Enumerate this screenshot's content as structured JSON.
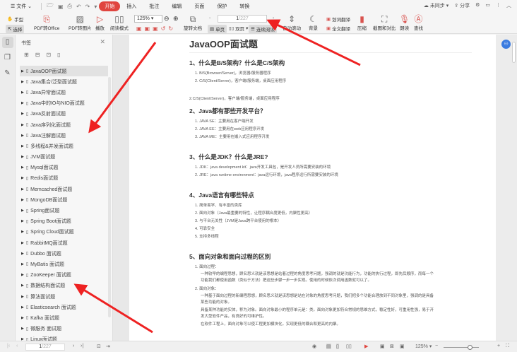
{
  "menubar": {
    "file": "文件",
    "items": [
      "开始",
      "插入",
      "批注",
      "编辑",
      "页面",
      "保护",
      "转换"
    ],
    "active": "开始",
    "sync": "未同步",
    "share": "分享"
  },
  "toolbar": {
    "hand": "手型",
    "select": "选择",
    "pdf_to_office": "PDF转Office",
    "pdf_to_image": "PDF转图片",
    "play": "播放",
    "read_mode": "阅读模式",
    "zoom": "125%",
    "rotate": "旋转文档",
    "page_current": "1",
    "page_total": "/227",
    "single": "单页",
    "double": "双页",
    "continuous": "连续阅读",
    "auto_scroll": "自动滚动",
    "background": "背景",
    "word_translate": "划词翻译",
    "full_translate": "全文翻译",
    "compress": "压缩",
    "screenshot_compare": "截图和对比",
    "read_aloud": "朗读",
    "find": "查找"
  },
  "panel": {
    "title": "书签",
    "bookmarks": [
      "JavaOOP面试题",
      "Java集合/泛型面试题",
      "Java异常面试题",
      "Java中的IO与NIO面试题",
      "Java反射面试题",
      "Java序列化面试题",
      "Java注解面试题",
      "多线程&并发面试题",
      "JVM面试题",
      "Mysql面试题",
      "Redis面试题",
      "Memcached面试题",
      "MongoDB面试题",
      "Spring面试题",
      "Spring Boot面试题",
      "Spring Cloud面试题",
      "RabbitMQ面试题",
      "Dubbo 面试题",
      "MyBatis 面试题",
      "ZooKeeper 面试题",
      "数据结构面试题",
      "算法面试题",
      "Elasticsearch 面试题",
      "Kafka 面试题",
      "微服务 面试题",
      "Linux面试题"
    ]
  },
  "doc": {
    "title": "JavaOOP面试题",
    "s1": {
      "h": "1、什么是B/S架构？什么是C/S架构",
      "items": [
        "1. B/S(Browser/Server)，浏览器/服务器程序",
        "2. C/S(Client/Server)，客户端/服务端，桌面应用程序"
      ],
      "extra": "2.C/S(Client/Server)，客户端/服务端，桌面应用程序"
    },
    "s2": {
      "h": "2、Java都有那些开发平台？",
      "items": [
        "1. JAVA SE：主要用在客户端开发",
        "2. JAVA EE：主要用在web应用程序开发",
        "3. JAVA ME：主要用在嵌入式应用程序开发"
      ]
    },
    "s3": {
      "h": "3、什么是JDK？什么是JRE?",
      "items": [
        "1. JDK：java development kit：java开发工具包，是开发人员所需要安装的环境",
        "2. JRE：java runtime environment：java运行环境，java程序运行所需要安装的环境"
      ]
    },
    "s4": {
      "h": "4、Java语言有哪些特点",
      "items": [
        "1. 简单易学、有丰富的类库",
        "2. 面向对象（Java最重要的特性，让程序耦合度更低，内聚性更高）",
        "3. 与平台无关性（JVM是Java跨平台使用的根本）",
        "4. 可靠安全",
        "5. 支持多线程"
      ]
    },
    "s5": {
      "h": "5、面向对象和面向过程的区别",
      "i1": "1. 面向过程：",
      "p1": "一种较早的编程思想，顾名思义就是该思想是站着过程的角度思考问题，强调的就是功能行为，功能的执行过程，即先后顺序，而每一个功能我们都使用函数（类似于方法）把这些步骤一步一步实现。使用的时候依次调用函数就可以了。",
      "i2": "2. 面向对象：",
      "p2": "一种基于面向过程的新编程思想，顾名思义就是该思想是站在对象的角度思考问题，我们把多个功能合理放到不同对象里，强调的是具备某些功能的对象。",
      "p3": "具备某种功能的实体，称为对象。面向对象最小的程序单元是：类。面向对象更加符合常规的思维方式，稳定性好，可重用性强，易于开发大型软件产品，有良好的可维护性。",
      "p4": "在软件工程上，面向对象可以使工程更加模块化，实现更低的耦合和更高的内聚。"
    }
  },
  "status": {
    "page_current": "1",
    "page_total": "/227",
    "zoom": "125%"
  },
  "colors": {
    "accent": "#e0453f",
    "arrow": "#ee2222",
    "blue": "#3a7be0"
  }
}
